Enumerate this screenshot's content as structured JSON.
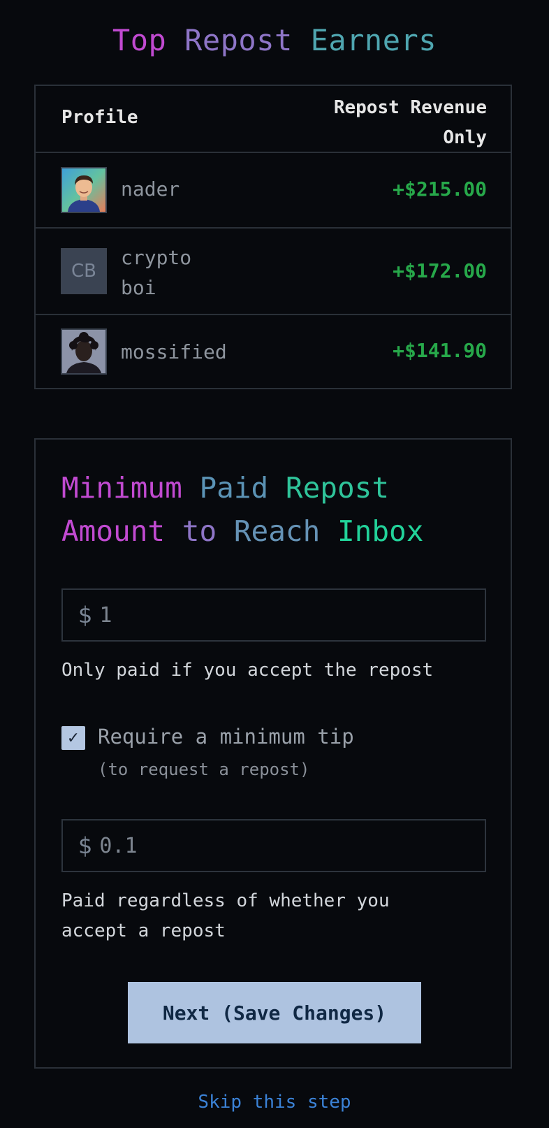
{
  "title_words": [
    "Top",
    "Repost",
    "Earners"
  ],
  "table": {
    "header_profile": "Profile",
    "header_revenue_line1": "Repost Revenue",
    "header_revenue_line2": "Only",
    "rows": [
      {
        "name": "nader",
        "amount": "+$215.00"
      },
      {
        "name_line1": "crypto",
        "name_line2": "boi",
        "initials": "CB",
        "amount": "+$172.00"
      },
      {
        "name": "mossified",
        "amount": "+$141.90"
      }
    ]
  },
  "card": {
    "title_words": [
      "Minimum",
      "Paid",
      "Repost",
      "Amount",
      "to",
      "Reach",
      "Inbox"
    ],
    "min_repost": {
      "currency": "$",
      "value": "1"
    },
    "min_repost_help": "Only paid if you accept the repost",
    "require_tip_label": "Require a minimum tip",
    "require_tip_sub": "(to request a repost)",
    "require_tip_checked": true,
    "checkbox_glyph": "✓",
    "min_tip": {
      "currency": "$",
      "value": "0.1"
    },
    "min_tip_help": "Paid regardless of whether you accept a repost",
    "next_button": "Next (Save Changes)"
  },
  "skip_link": "Skip this step",
  "colors": {
    "background": "#07090d",
    "positive_amount": "#27a84a",
    "button_bg": "#aec3e0",
    "link": "#3b82d6"
  }
}
